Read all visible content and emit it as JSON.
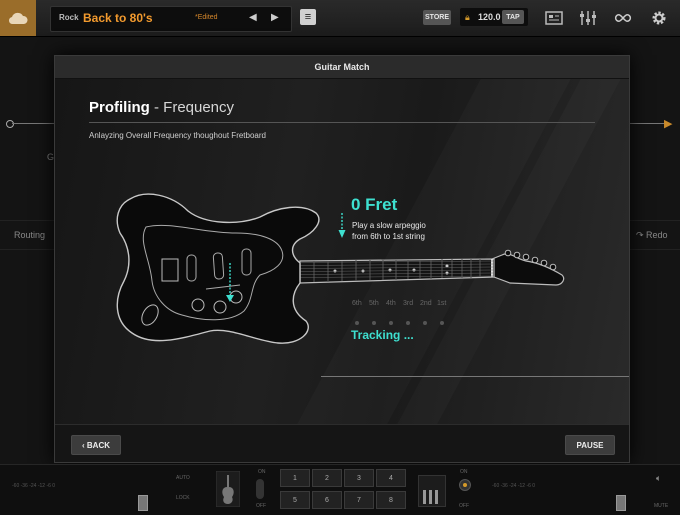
{
  "topbar": {
    "category": "Rock",
    "preset_name": "Back to 80's",
    "edited_tag": "*Edited",
    "prev_icon": "triangle-left-icon",
    "next_icon": "triangle-right-icon",
    "store_label": "STORE",
    "tempo": "120.0",
    "tap_label": "TAP"
  },
  "background": {
    "routing_label": "Routing",
    "redo_label": "Redo",
    "chain_letter": "G"
  },
  "modal": {
    "title": "Guitar Match",
    "heading_bold": "Profiling",
    "heading_rest": " - Frequency",
    "description": "Anlayzing Overall Frequency thoughout Fretboard",
    "fret": "0 Fret",
    "instruction_line1": "Play a slow arpeggio",
    "instruction_line2": "from 6th to 1st string",
    "strings": [
      "6th",
      "5th",
      "4th",
      "3rd",
      "2nd",
      "1st"
    ],
    "status": "Tracking ...",
    "back_label": "‹ BACK",
    "pause_label": "PAUSE"
  },
  "bottombar": {
    "auto_label": "AUTO",
    "lock_label": "LOCK",
    "on_label": "ON",
    "off_label": "OFF",
    "mute_label": "MUTE",
    "meter_scale": "-60  -36  -24  -12   -6   0",
    "pads": [
      "1",
      "2",
      "3",
      "4",
      "5",
      "6",
      "7",
      "8"
    ]
  },
  "colors": {
    "accent_teal": "#3ee0d0",
    "preset_orange": "#f29a2e",
    "logo_brown": "#9a6d2a"
  }
}
